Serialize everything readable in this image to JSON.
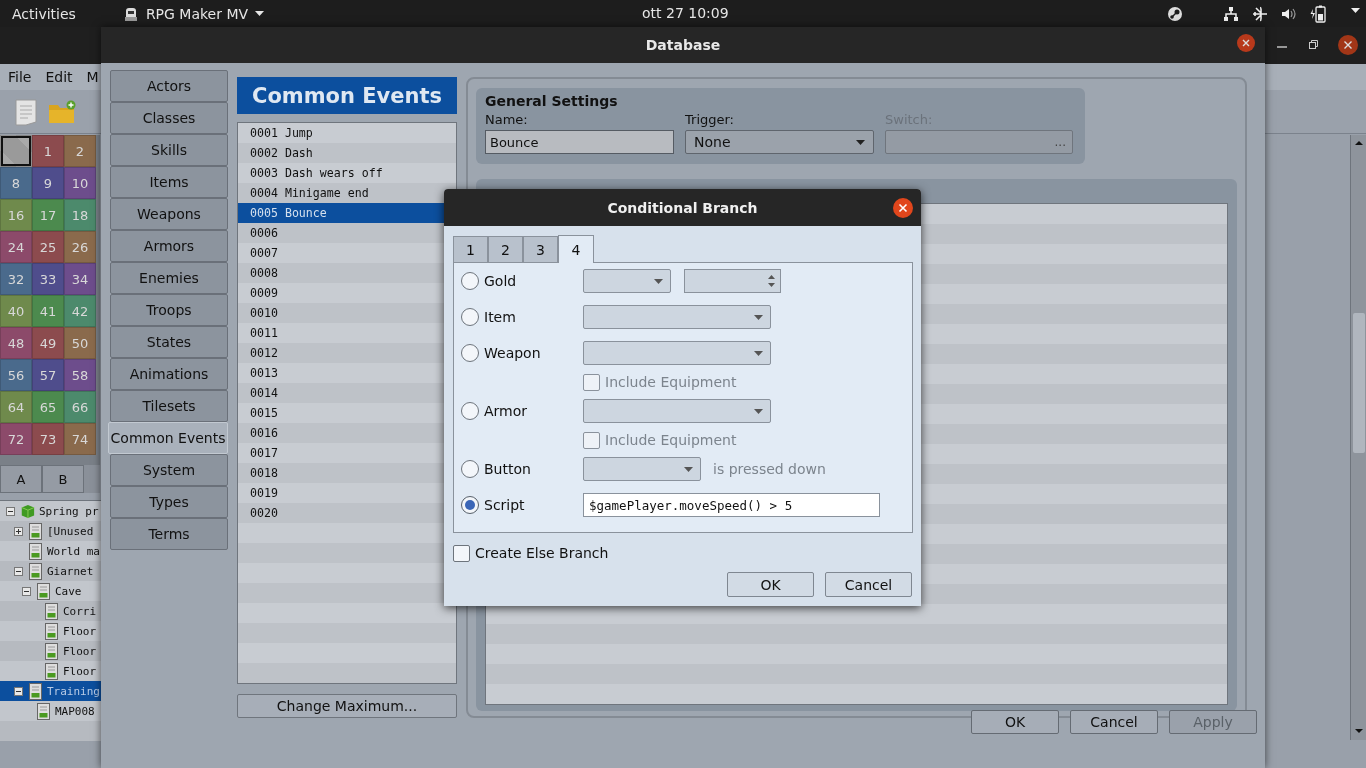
{
  "top_bar": {
    "activities": "Activities",
    "app_menu": "RPG Maker MV",
    "clock": "ott 27  10:09"
  },
  "main_window": {
    "menus": [
      "File",
      "Edit",
      "M"
    ],
    "palette": [
      {
        "selected": true,
        "color": "#9a9a9a"
      },
      {
        "label": "1",
        "selected": false,
        "color": "#8c4b4e"
      },
      {
        "label": "2",
        "selected": false,
        "color": "#8a6a4c"
      },
      {
        "label": "8",
        "selected": false,
        "color": "#4a6a8c"
      },
      {
        "label": "9",
        "selected": false,
        "color": "#4f4d8c"
      },
      {
        "label": "10",
        "selected": false,
        "color": "#6d4d8c"
      },
      {
        "label": "16",
        "selected": false,
        "color": "#6f8a4c"
      },
      {
        "label": "17",
        "selected": false,
        "color": "#4c8a4e"
      },
      {
        "label": "18",
        "selected": false,
        "color": "#4c8a6c"
      },
      {
        "label": "24",
        "selected": false,
        "color": "#8c4a6a"
      },
      {
        "label": "25",
        "selected": false,
        "color": "#8c4b4e"
      },
      {
        "label": "26",
        "selected": false,
        "color": "#8a6a4c"
      },
      {
        "label": "32",
        "selected": false,
        "color": "#4a6a8c"
      },
      {
        "label": "33",
        "selected": false,
        "color": "#4f4d8c"
      },
      {
        "label": "34",
        "selected": false,
        "color": "#6d4d8c"
      },
      {
        "label": "40",
        "selected": false,
        "color": "#6f8a4c"
      },
      {
        "label": "41",
        "selected": false,
        "color": "#4c8a4e"
      },
      {
        "label": "42",
        "selected": false,
        "color": "#4c8a6c"
      },
      {
        "label": "48",
        "selected": false,
        "color": "#8c4a6a"
      },
      {
        "label": "49",
        "selected": false,
        "color": "#8c4b4e"
      },
      {
        "label": "50",
        "selected": false,
        "color": "#8a6a4c"
      },
      {
        "label": "56",
        "selected": false,
        "color": "#4a6a8c"
      },
      {
        "label": "57",
        "selected": false,
        "color": "#4f4d8c"
      },
      {
        "label": "58",
        "selected": false,
        "color": "#6d4d8c"
      },
      {
        "label": "64",
        "selected": false,
        "color": "#6f8a4c"
      },
      {
        "label": "65",
        "selected": false,
        "color": "#4c8a4e"
      },
      {
        "label": "66",
        "selected": false,
        "color": "#4c8a6c"
      },
      {
        "label": "72",
        "selected": false,
        "color": "#8c4a6a"
      },
      {
        "label": "73",
        "selected": false,
        "color": "#8c4b4e"
      },
      {
        "label": "74",
        "selected": false,
        "color": "#8a6a4c"
      }
    ],
    "palette_tabs": [
      "A",
      "B"
    ],
    "map_tree": [
      {
        "name": "Spring pr",
        "kind": "project",
        "expanded": true,
        "selected": false,
        "children": [
          {
            "name": "[Unused",
            "kind": "map",
            "expanded": false,
            "selected": false
          },
          {
            "name": "World ma",
            "kind": "map",
            "selected": false
          },
          {
            "name": "Giarnet",
            "kind": "map",
            "expanded": true,
            "selected": false,
            "children": [
              {
                "name": "Cave",
                "kind": "map",
                "expanded": true,
                "selected": false,
                "children": [
                  {
                    "name": "Corri",
                    "kind": "map",
                    "selected": false
                  },
                  {
                    "name": "Floor",
                    "kind": "map",
                    "selected": false
                  },
                  {
                    "name": "Floor",
                    "kind": "map",
                    "selected": false
                  },
                  {
                    "name": "Floor",
                    "kind": "map",
                    "selected": false
                  }
                ]
              }
            ]
          },
          {
            "name": "Training",
            "kind": "map",
            "expanded": true,
            "selected": true,
            "children": [
              {
                "name": "MAP008",
                "kind": "map",
                "selected": false
              }
            ]
          }
        ]
      }
    ]
  },
  "database": {
    "title": "Database",
    "categories": [
      {
        "label": "Actors",
        "selected": false
      },
      {
        "label": "Classes",
        "selected": false
      },
      {
        "label": "Skills",
        "selected": false
      },
      {
        "label": "Items",
        "selected": false
      },
      {
        "label": "Weapons",
        "selected": false
      },
      {
        "label": "Armors",
        "selected": false
      },
      {
        "label": "Enemies",
        "selected": false
      },
      {
        "label": "Troops",
        "selected": false
      },
      {
        "label": "States",
        "selected": false
      },
      {
        "label": "Animations",
        "selected": false
      },
      {
        "label": "Tilesets",
        "selected": false
      },
      {
        "label": "Common Events",
        "selected": true
      },
      {
        "label": "System",
        "selected": false
      },
      {
        "label": "Types",
        "selected": false
      },
      {
        "label": "Terms",
        "selected": false
      }
    ],
    "list_header": "Common Events",
    "events": [
      {
        "label": "0001 Jump",
        "selected": false
      },
      {
        "label": "0002 Dash",
        "selected": false
      },
      {
        "label": "0003 Dash wears off",
        "selected": false
      },
      {
        "label": "0004 Minigame end",
        "selected": false
      },
      {
        "label": "0005 Bounce",
        "selected": true
      },
      {
        "label": "0006",
        "selected": false
      },
      {
        "label": "0007",
        "selected": false
      },
      {
        "label": "0008",
        "selected": false
      },
      {
        "label": "0009",
        "selected": false
      },
      {
        "label": "0010",
        "selected": false
      },
      {
        "label": "0011",
        "selected": false
      },
      {
        "label": "0012",
        "selected": false
      },
      {
        "label": "0013",
        "selected": false
      },
      {
        "label": "0014",
        "selected": false
      },
      {
        "label": "0015",
        "selected": false
      },
      {
        "label": "0016",
        "selected": false
      },
      {
        "label": "0017",
        "selected": false
      },
      {
        "label": "0018",
        "selected": false
      },
      {
        "label": "0019",
        "selected": false
      },
      {
        "label": "0020",
        "selected": false
      }
    ],
    "change_maximum": "Change Maximum...",
    "general_settings": {
      "title": "General Settings",
      "name_label": "Name:",
      "name_value": "Bounce",
      "trigger_label": "Trigger:",
      "trigger_value": "None",
      "switch_label": "Switch:",
      "switch_button": "...",
      "switch_disabled": true
    },
    "buttons": [
      {
        "label": "OK",
        "disabled": false
      },
      {
        "label": "Cancel",
        "disabled": false
      },
      {
        "label": "Apply",
        "disabled": true
      }
    ]
  },
  "dialog": {
    "title": "Conditional Branch",
    "tabs": [
      {
        "label": "1",
        "selected": false
      },
      {
        "label": "2",
        "selected": false
      },
      {
        "label": "3",
        "selected": false
      },
      {
        "label": "4",
        "selected": true
      }
    ],
    "conditions": [
      {
        "label": "Gold",
        "kind": "gold",
        "selected": false
      },
      {
        "label": "Item",
        "kind": "item",
        "selected": false
      },
      {
        "label": "Weapon",
        "kind": "equip",
        "selected": false,
        "include_label": "Include Equipment",
        "include_checked": false
      },
      {
        "label": "Armor",
        "kind": "equip",
        "selected": false,
        "include_label": "Include Equipment",
        "include_checked": false
      },
      {
        "label": "Button",
        "kind": "button",
        "selected": false,
        "suffix": "is pressed down"
      },
      {
        "label": "Script",
        "kind": "script",
        "selected": true,
        "value": "$gamePlayer.moveSpeed() > 5"
      }
    ],
    "else_branch": {
      "label": "Create Else Branch",
      "checked": false
    },
    "buttons": [
      "OK",
      "Cancel"
    ]
  }
}
